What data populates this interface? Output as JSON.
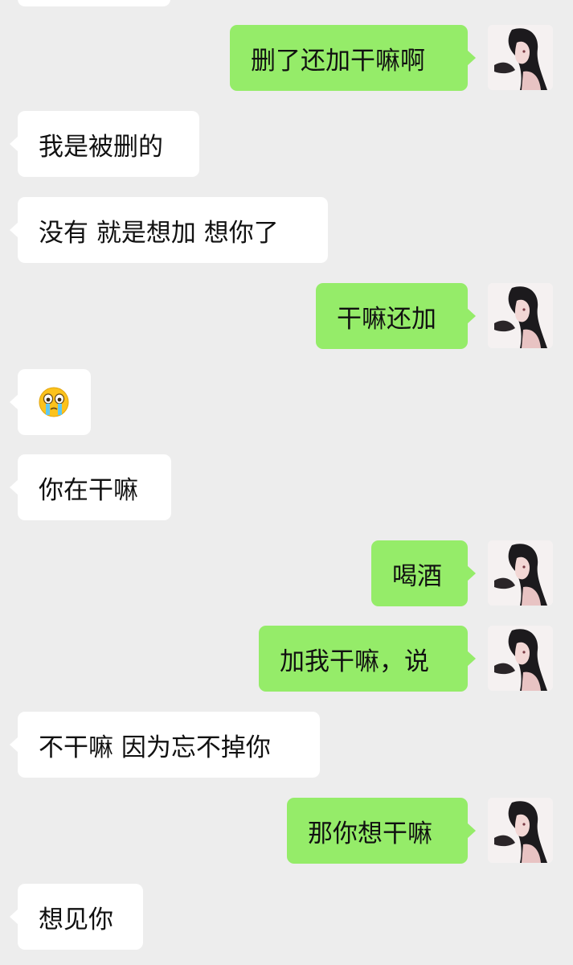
{
  "colors": {
    "background": "#ededed",
    "incoming_bubble": "#ffffff",
    "outgoing_bubble": "#95ec69",
    "text": "#111111"
  },
  "messages": [
    {
      "side": "out",
      "text": "删了还加干嘛啊"
    },
    {
      "side": "in",
      "text": "我是被删的"
    },
    {
      "side": "in",
      "text": "没有 就是想加 想你了"
    },
    {
      "side": "out",
      "text": "干嘛还加"
    },
    {
      "side": "in",
      "emoji": "crying-face-emoji"
    },
    {
      "side": "in",
      "text": "你在干嘛"
    },
    {
      "side": "out",
      "text": "喝酒"
    },
    {
      "side": "out",
      "text": "加我干嘛，说"
    },
    {
      "side": "in",
      "text": "不干嘛 因为忘不掉你"
    },
    {
      "side": "out",
      "text": "那你想干嘛"
    },
    {
      "side": "in",
      "text": "想见你"
    }
  ]
}
